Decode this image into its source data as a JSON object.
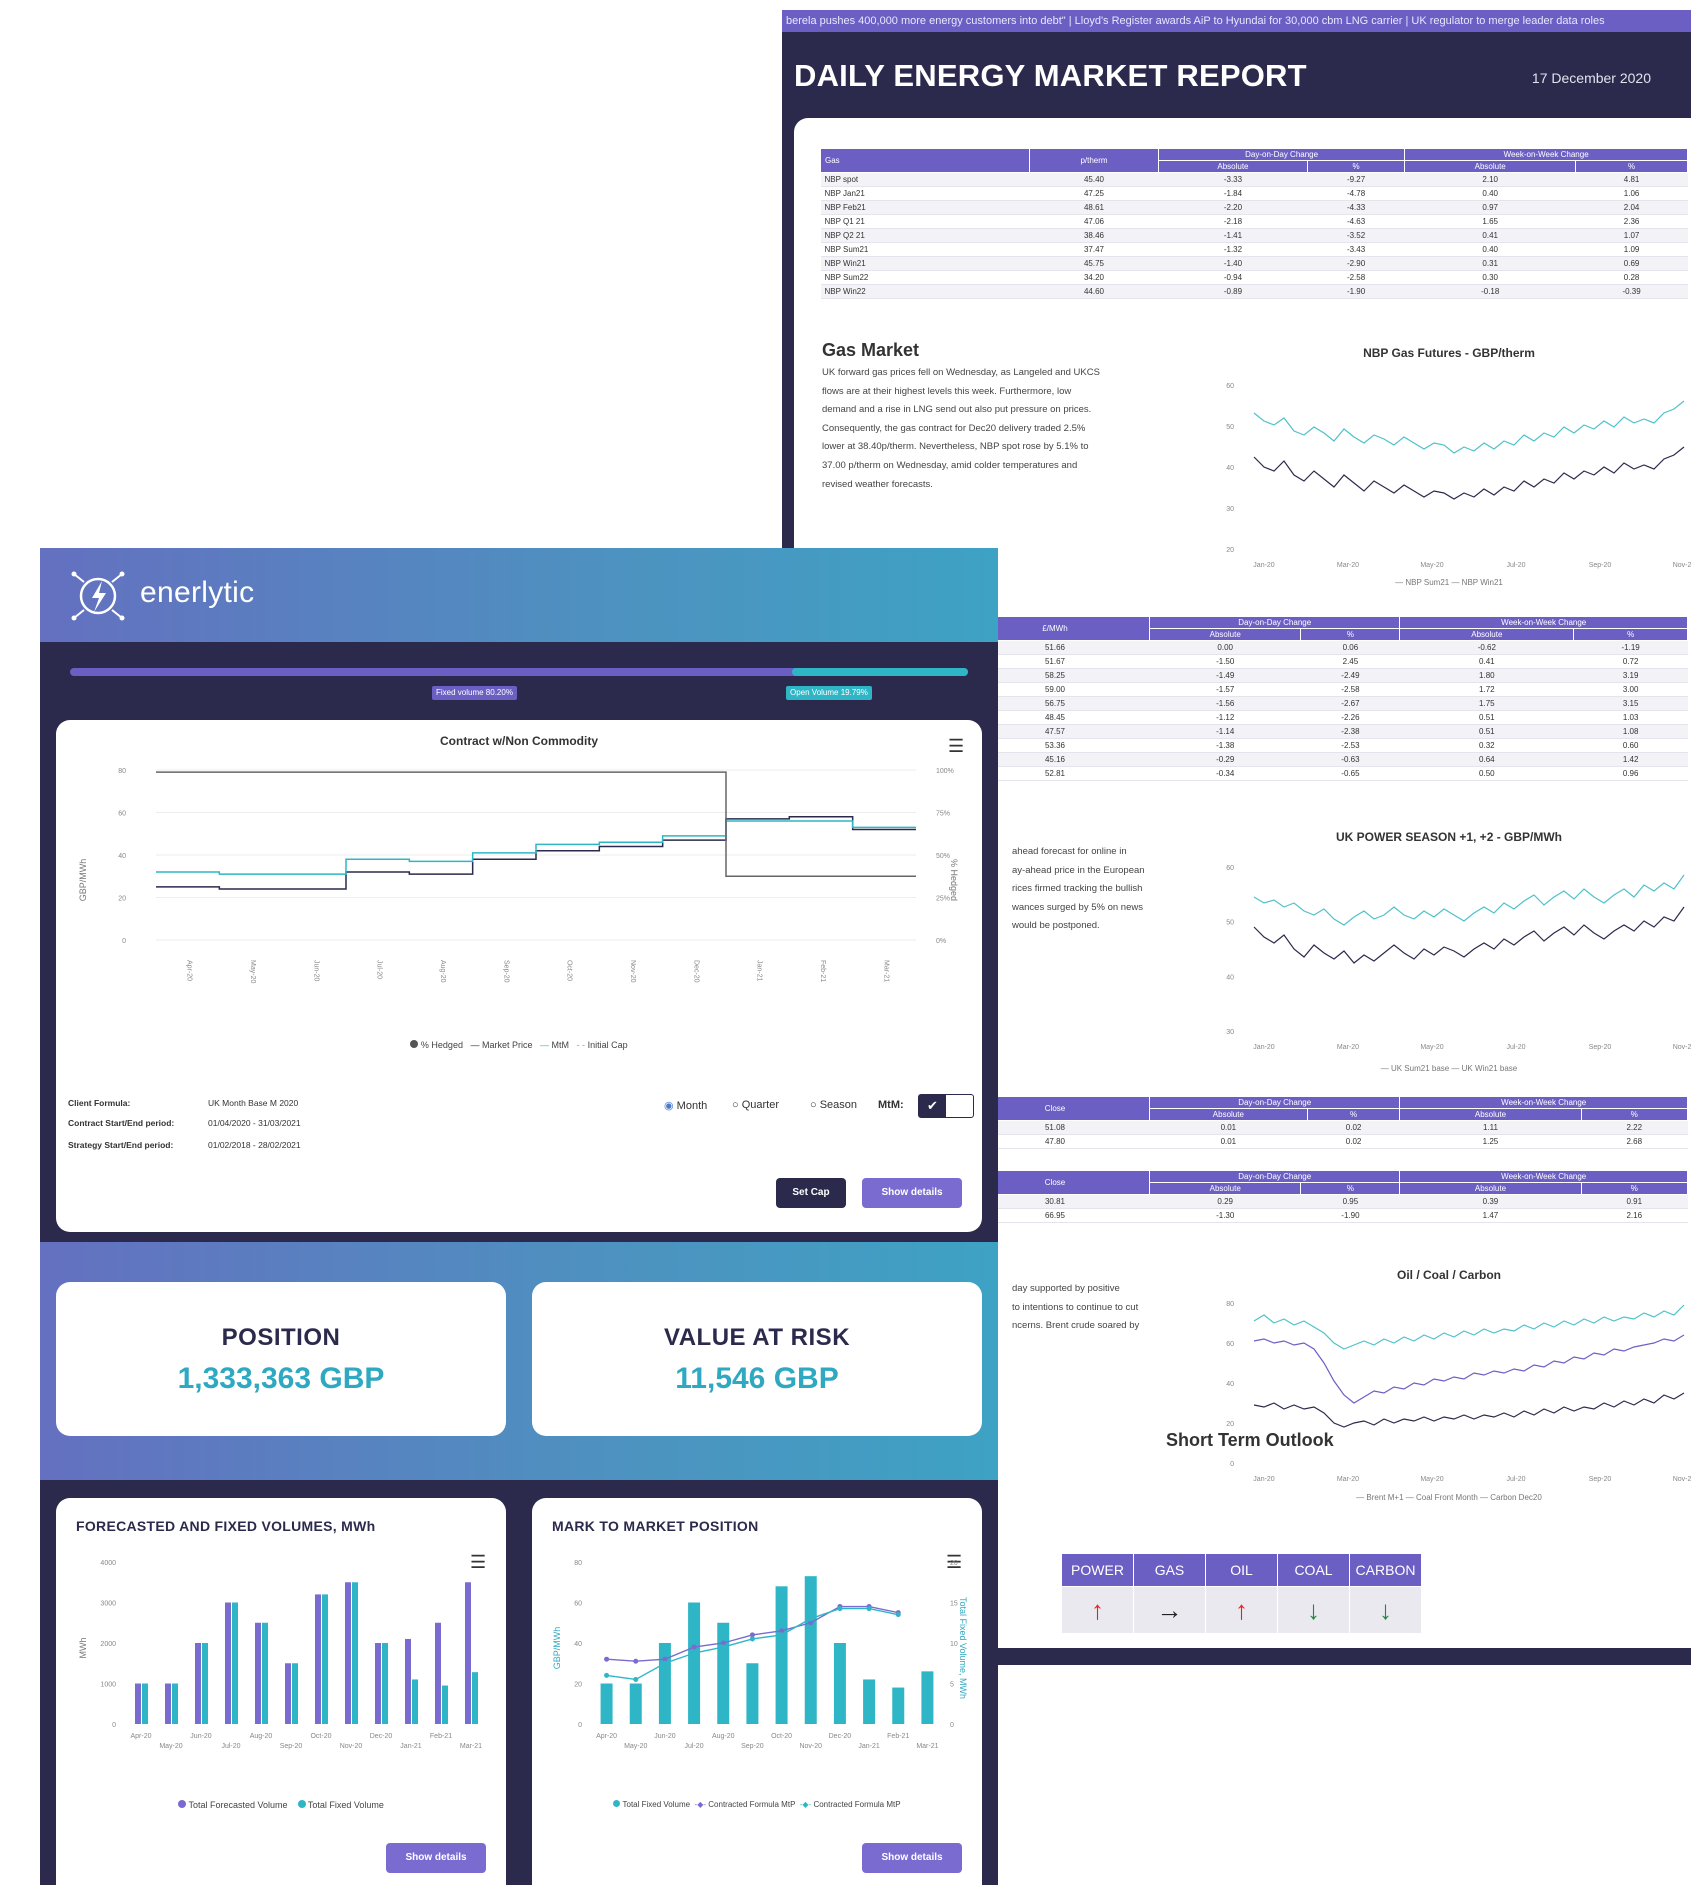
{
  "report": {
    "ticker": "berela pushes 400,000 more energy customers into debt\" | Lloyd's Register awards AiP to Hyundai for 30,000 cbm LNG carrier | UK regulator to merge leader data roles",
    "title": "DAILY ENERGY MARKET REPORT",
    "date": "17 December 2020",
    "gas_table": {
      "headers": {
        "product": "Gas",
        "price": "p/therm",
        "dod": "Day-on-Day Change",
        "wow": "Week-on-Week Change",
        "abs": "Absolute",
        "pct": "%"
      },
      "rows": [
        [
          "NBP spot",
          "45.40",
          "-3.33",
          "-9.27",
          "2.10",
          "4.81"
        ],
        [
          "NBP Jan21",
          "47.25",
          "-1.84",
          "-4.78",
          "0.40",
          "1.06"
        ],
        [
          "NBP Feb21",
          "48.61",
          "-2.20",
          "-4.33",
          "0.97",
          "2.04"
        ],
        [
          "NBP Q1 21",
          "47.06",
          "-2.18",
          "-4.63",
          "1.65",
          "2.36"
        ],
        [
          "NBP Q2 21",
          "38.46",
          "-1.41",
          "-3.52",
          "0.41",
          "1.07"
        ],
        [
          "NBP Sum21",
          "37.47",
          "-1.32",
          "-3.43",
          "0.40",
          "1.09"
        ],
        [
          "NBP Win21",
          "45.75",
          "-1.40",
          "-2.90",
          "0.31",
          "0.69"
        ],
        [
          "NBP Sum22",
          "34.20",
          "-0.94",
          "-2.58",
          "0.30",
          "0.28"
        ],
        [
          "NBP Win22",
          "44.60",
          "-0.89",
          "-1.90",
          "-0.18",
          "-0.39"
        ]
      ]
    },
    "gas_market": {
      "title": "Gas Market",
      "lines": [
        "UK forward gas prices fell on Wednesday, as Langeled and UKCS",
        "flows are at their highest levels this week. Furthermore, low",
        "demand and a rise in LNG send out also put pressure on prices.",
        "Consequently, the gas contract for Dec20 delivery traded 2.5%",
        "lower at 38.40p/therm. Nevertheless, NBP spot rose by 5.1% to",
        "37.00 p/therm on Wednesday, amid colder temperatures and",
        "revised weather forecasts."
      ]
    },
    "gas_chart": {
      "title": "NBP Gas Futures - GBP/therm",
      "yticks": [
        "60",
        "50",
        "40",
        "30",
        "20"
      ],
      "xticks": [
        "Jan-20",
        "Mar-20",
        "May-20",
        "Jul-20",
        "Sep-20",
        "Nov-20"
      ],
      "legend": "— NBP Sum21 — NBP Win21"
    },
    "power_table": {
      "headers": {
        "price": "£/MWh",
        "dod": "Day-on-Day Change",
        "wow": "Week-on-Week Change",
        "abs": "Absolute",
        "pct": "%"
      },
      "rows": [
        [
          "51.66",
          "0.00",
          "0.06",
          "-0.62",
          "-1.19"
        ],
        [
          "51.67",
          "-1.50",
          "2.45",
          "0.41",
          "0.72"
        ],
        [
          "58.25",
          "-1.49",
          "-2.49",
          "1.80",
          "3.19"
        ],
        [
          "59.00",
          "-1.57",
          "-2.58",
          "1.72",
          "3.00"
        ],
        [
          "56.75",
          "-1.56",
          "-2.67",
          "1.75",
          "3.15"
        ],
        [
          "48.45",
          "-1.12",
          "-2.26",
          "0.51",
          "1.03"
        ],
        [
          "47.57",
          "-1.14",
          "-2.38",
          "0.51",
          "1.08"
        ],
        [
          "53.36",
          "-1.38",
          "-2.53",
          "0.32",
          "0.60"
        ],
        [
          "45.16",
          "-0.29",
          "-0.63",
          "0.64",
          "1.42"
        ],
        [
          "52.81",
          "-0.34",
          "-0.65",
          "0.50",
          "0.96"
        ]
      ]
    },
    "power_text": {
      "lines": [
        "ahead forecast for online in",
        "ay-ahead price in the European",
        "rices firmed tracking the bullish",
        "wances surged by 5% on news",
        "would be postponed."
      ]
    },
    "power_chart": {
      "title": "UK POWER SEASON +1, +2 - GBP/MWh",
      "yticks": [
        "60",
        "50",
        "40",
        "30"
      ],
      "xticks": [
        "Jan-20",
        "Mar-20",
        "May-20",
        "Jul-20",
        "Sep-20",
        "Nov-20"
      ],
      "legend": "— UK Sum21 base — UK Win21 base"
    },
    "small_table_1": {
      "headers": {
        "price": "Close",
        "dod": "Day-on-Day Change",
        "wow": "Week-on-Week Change",
        "abs": "Absolute",
        "pct": "%"
      },
      "rows": [
        [
          "51.08",
          "0.01",
          "0.02",
          "1.11",
          "2.22"
        ],
        [
          "47.80",
          "0.01",
          "0.02",
          "1.25",
          "2.68"
        ]
      ]
    },
    "small_table_2": {
      "headers": {
        "price": "Close",
        "dod": "Day-on-Day Change",
        "wow": "Week-on-Week Change",
        "abs": "Absolute",
        "pct": "%"
      },
      "rows": [
        [
          "30.81",
          "0.29",
          "0.95",
          "0.39",
          "0.91"
        ],
        [
          "66.95",
          "-1.30",
          "-1.90",
          "1.47",
          "2.16"
        ]
      ]
    },
    "oil_text": {
      "lines": [
        "day supported by positive",
        "to intentions to continue to cut",
        "ncerns. Brent crude soared by"
      ]
    },
    "oil_chart": {
      "title": "Oil / Coal / Carbon",
      "yticks": [
        "80",
        "60",
        "40",
        "20",
        "0"
      ],
      "xticks": [
        "Jan-20",
        "Mar-20",
        "May-20",
        "Jul-20",
        "Sep-20",
        "Nov-20"
      ],
      "legend": "— Brent M+1 — Coal Front Month — Carbon Dec20"
    },
    "outlook": {
      "title": "Short Term Outlook",
      "columns": [
        "POWER",
        "GAS",
        "OIL",
        "COAL",
        "CARBON"
      ],
      "arrows": [
        "↑",
        "→",
        "↑",
        "↓",
        "↓"
      ],
      "colors": [
        "#e02424",
        "#222222",
        "#e02424",
        "#1e8a3c",
        "#1e8a3c"
      ]
    }
  },
  "app": {
    "brand": "enerlytic",
    "slider": {
      "left_tag": "Fixed volume 80.20%",
      "right_tag": "Open Volume 19.79%",
      "fixed_fraction": 0.802
    },
    "contract_chart": {
      "title": "Contract w/Non Commodity",
      "y_left_label": "GBP/MWh",
      "y_right_label": "% Hedged",
      "y_left_ticks": [
        "80",
        "60",
        "40",
        "20",
        "0"
      ],
      "y_right_ticks": [
        "100%",
        "75%",
        "50%",
        "25%",
        "0%"
      ],
      "x_ticks": [
        "Apr-20",
        "May-20",
        "Jun-20",
        "Jul-20",
        "Aug-20",
        "Sep-20",
        "Oct-20",
        "Nov-20",
        "Dec-20",
        "Jan-21",
        "Feb-21",
        "Mar-21"
      ],
      "legend": [
        "% Hedged",
        "Market Price",
        "MtM",
        "Initial Cap"
      ]
    },
    "chart_data": [
      {
        "type": "line",
        "title": "Contract w/Non Commodity",
        "x": [
          "Apr-20",
          "May-20",
          "Jun-20",
          "Jul-20",
          "Aug-20",
          "Sep-20",
          "Oct-20",
          "Nov-20",
          "Dec-20",
          "Jan-21",
          "Feb-21",
          "Mar-21"
        ],
        "ylabel": "GBP/MWh",
        "ylim": [
          0,
          80
        ],
        "series": [
          {
            "name": "Market Price",
            "values": [
              25,
              24,
              24,
              32,
              31,
              38,
              42,
              44,
              47,
              57,
              58,
              52
            ]
          },
          {
            "name": "MtM",
            "values": [
              32,
              31,
              31,
              38,
              37,
              41,
              45,
              46,
              49,
              56,
              56,
              53
            ]
          },
          {
            "name": "Initial Cap",
            "values": [
              79,
              79,
              79,
              79,
              79,
              79,
              79,
              79,
              79,
              30,
              30,
              30
            ]
          }
        ]
      },
      {
        "type": "bar",
        "title": "FORECASTED AND FIXED VOLUMES, MWh",
        "categories": [
          "Apr-20",
          "May-20",
          "Jun-20",
          "Jul-20",
          "Aug-20",
          "Sep-20",
          "Oct-20",
          "Nov-20",
          "Dec-20",
          "Jan-21",
          "Feb-21",
          "Mar-21"
        ],
        "ylabel": "MWh",
        "ylim": [
          0,
          4000
        ],
        "series": [
          {
            "name": "Total Forecasted Volume",
            "values": [
              1000,
              1000,
              2000,
              3000,
              2500,
              1500,
              3200,
              3500,
              2000,
              2100,
              2500,
              3500
            ]
          },
          {
            "name": "Total Fixed Volume",
            "values": [
              1000,
              1000,
              2000,
              3000,
              2500,
              1500,
              3200,
              3500,
              2000,
              1100,
              950,
              1280
            ]
          }
        ]
      },
      {
        "type": "bar",
        "title": "MARK TO MARKET POSITION",
        "categories": [
          "Apr-20",
          "May-20",
          "Jun-20",
          "Jul-20",
          "Aug-20",
          "Sep-20",
          "Oct-20",
          "Nov-20",
          "Dec-20",
          "Jan-21",
          "Feb-21",
          "Mar-21"
        ],
        "ylabel": "GBP/MWh",
        "ylim": [
          0,
          80
        ],
        "series": [
          {
            "name": "Total Fixed Volume",
            "values": [
              20,
              20,
              40,
              60,
              50,
              30,
              68,
              73,
              40,
              22,
              18,
              26
            ]
          },
          {
            "name": "Contracted Formula MtP",
            "values": [
              32,
              31,
              32,
              38,
              40,
              44,
              46,
              50,
              58,
              58,
              55,
              0
            ]
          },
          {
            "name": "Contracted Formula MtP ",
            "values": [
              24,
              22,
              30,
              35,
              38,
              42,
              44,
              52,
              57,
              57,
              54,
              0
            ]
          }
        ]
      }
    ],
    "contract_info": {
      "client_formula_label": "Client Formula:",
      "client_formula_value": "UK Month Base M 2020",
      "contract_period_label": "Contract Start/End period:",
      "contract_period_value": "01/04/2020 - 31/03/2021",
      "strategy_period_label": "Strategy Start/End period:",
      "strategy_period_value": "01/02/2018 - 28/02/2021"
    },
    "period_options": [
      "Month",
      "Quarter",
      "Season"
    ],
    "period_selected": "Month",
    "mtm_label": "MtM:",
    "buttons": {
      "set_cap": "Set Cap",
      "show_details": "Show details"
    },
    "metrics": {
      "position_label": "POSITION",
      "position_value": "1,333,363 GBP",
      "var_label": "VALUE AT RISK",
      "var_value": "11,546 GBP"
    },
    "volumes_chart": {
      "title": "FORECASTED AND FIXED VOLUMES, MWh",
      "ylabel": "MWh",
      "yticks": [
        "4000",
        "3000",
        "2000",
        "1000",
        "0"
      ],
      "xticks": [
        "Apr-20",
        "May-20",
        "Jun-20",
        "Jul-20",
        "Aug-20",
        "Sep-20",
        "Oct-20",
        "Nov-20",
        "Dec-20",
        "Jan-21",
        "Feb-21",
        "Mar-21"
      ],
      "legend": [
        "Total Forecasted Volume",
        "Total Fixed Volume"
      ],
      "colors": [
        "#7a6bd0",
        "#2fb6c6"
      ]
    },
    "mtm_chart": {
      "title": "MARK TO MARKET POSITION",
      "ylabel": "GBP/MWh",
      "y_right_label": "Total Fixed Volume, MWh",
      "yticks": [
        "80",
        "60",
        "40",
        "20",
        "0"
      ],
      "y_right_ticks": [
        "20",
        "15",
        "10",
        "5",
        "0"
      ],
      "xticks": [
        "Apr-20",
        "May-20",
        "Jun-20",
        "Jul-20",
        "Aug-20",
        "Sep-20",
        "Oct-20",
        "Nov-20",
        "Dec-20",
        "Jan-21",
        "Feb-21",
        "Mar-21"
      ],
      "legend": [
        "Total Fixed Volume",
        "Contracted Formula MtP",
        "Contracted Formula MtP"
      ]
    }
  }
}
